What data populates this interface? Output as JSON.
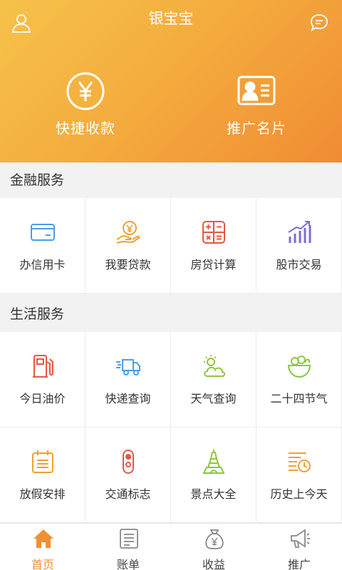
{
  "app": {
    "title": "银宝宝"
  },
  "header": {
    "user_icon": "user-icon",
    "message_icon": "message-icon",
    "quick_actions": [
      {
        "label": "快捷收款",
        "icon": "yen-circle-icon"
      },
      {
        "label": "推广名片",
        "icon": "business-card-icon"
      }
    ]
  },
  "finance": {
    "title": "金融服务",
    "items": [
      {
        "label": "办信用卡",
        "icon": "credit-card-icon"
      },
      {
        "label": "我要贷款",
        "icon": "loan-icon"
      },
      {
        "label": "房贷计算",
        "icon": "calculator-icon"
      },
      {
        "label": "股市交易",
        "icon": "stock-chart-icon"
      }
    ]
  },
  "life": {
    "title": "生活服务",
    "items": [
      {
        "label": "今日油价",
        "icon": "gas-pump-icon"
      },
      {
        "label": "快递查询",
        "icon": "delivery-truck-icon"
      },
      {
        "label": "天气查询",
        "icon": "weather-icon"
      },
      {
        "label": "二十四节气",
        "icon": "seasons-icon"
      },
      {
        "label": "放假安排",
        "icon": "calendar-icon"
      },
      {
        "label": "交通标志",
        "icon": "traffic-light-icon"
      },
      {
        "label": "景点大全",
        "icon": "tower-icon"
      },
      {
        "label": "历史上今天",
        "icon": "history-icon"
      }
    ]
  },
  "tabbar": {
    "tabs": [
      {
        "label": "首页",
        "icon": "home-icon",
        "active": true
      },
      {
        "label": "账单",
        "icon": "bill-icon",
        "active": false
      },
      {
        "label": "收益",
        "icon": "money-bag-icon",
        "active": false
      },
      {
        "label": "推广",
        "icon": "megaphone-icon",
        "active": false
      }
    ]
  },
  "colors": {
    "header_start": "#f6c24a",
    "header_end": "#f08c33",
    "accent": "#f08f34",
    "blue": "#4a9ee8",
    "red": "#e85545",
    "green": "#8dc63f",
    "purple": "#7a6bd8",
    "orange": "#f0a030"
  }
}
